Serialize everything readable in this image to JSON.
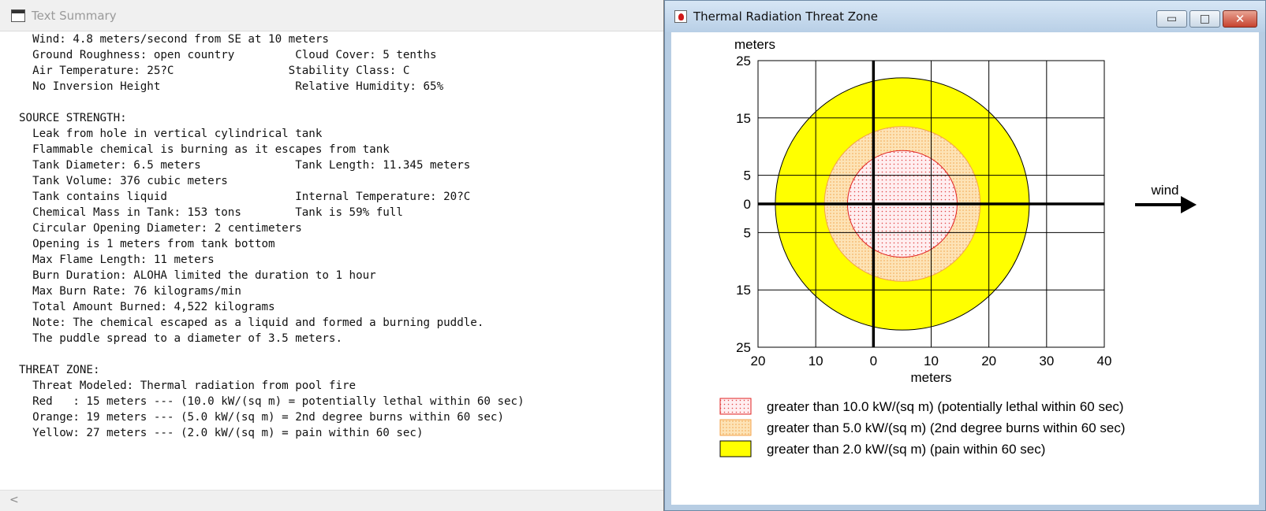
{
  "left_window": {
    "title": "Text Summary",
    "lines": [
      "  Wind: 4.8 meters/second from SE at 10 meters",
      "  Ground Roughness: open country         Cloud Cover: 5 tenths",
      "  Air Temperature: 25?C                 Stability Class: C",
      "  No Inversion Height                    Relative Humidity: 65%",
      "",
      "SOURCE STRENGTH:",
      "  Leak from hole in vertical cylindrical tank",
      "  Flammable chemical is burning as it escapes from tank",
      "  Tank Diameter: 6.5 meters              Tank Length: 11.345 meters",
      "  Tank Volume: 376 cubic meters",
      "  Tank contains liquid                   Internal Temperature: 20?C",
      "  Chemical Mass in Tank: 153 tons        Tank is 59% full",
      "  Circular Opening Diameter: 2 centimeters",
      "  Opening is 1 meters from tank bottom",
      "  Max Flame Length: 11 meters",
      "  Burn Duration: ALOHA limited the duration to 1 hour",
      "  Max Burn Rate: 76 kilograms/min",
      "  Total Amount Burned: 4,522 kilograms",
      "  Note: The chemical escaped as a liquid and formed a burning puddle.",
      "  The puddle spread to a diameter of 3.5 meters.",
      "",
      "THREAT ZONE:",
      "  Threat Modeled: Thermal radiation from pool fire",
      "  Red   : 15 meters --- (10.0 kW/(sq m) = potentially lethal within 60 sec)",
      "  Orange: 19 meters --- (5.0 kW/(sq m) = 2nd degree burns within 60 sec)",
      "  Yellow: 27 meters --- (2.0 kW/(sq m) = pain within 60 sec)"
    ],
    "scroll_left_glyph": "<"
  },
  "right_window": {
    "title": "Thermal Radiation Threat Zone",
    "controls": {
      "minimize": "▭",
      "maximize": "□",
      "close": "✕"
    }
  },
  "chart_data": {
    "type": "threat-zone-plot",
    "xlabel": "meters",
    "ylabel": "meters",
    "xlim": [
      -20,
      40
    ],
    "ylim": [
      -25,
      25
    ],
    "x_ticks": [
      -20,
      -10,
      0,
      10,
      20,
      30,
      40
    ],
    "x_tick_labels": [
      "20",
      "10",
      "0",
      "10",
      "20",
      "30",
      "40"
    ],
    "y_ticks": [
      25,
      15,
      5,
      0,
      -5,
      -15,
      -25
    ],
    "y_tick_labels": [
      "25",
      "15",
      "5",
      "0",
      "5",
      "15",
      "25"
    ],
    "grid": true,
    "wind_label": "wind",
    "zones": [
      {
        "level": "yellow",
        "center_x": 5,
        "rx": 22,
        "ry": 22,
        "fill": "#ffff00",
        "stroke": "#000000",
        "pattern": "solid",
        "legend": "greater than 2.0 kW/(sq m) (pain within 60 sec)"
      },
      {
        "level": "orange",
        "center_x": 5,
        "rx": 13.5,
        "ry": 13.5,
        "fill": "#fde3b6",
        "stroke": "#f3a24a",
        "pattern": "dots-orange",
        "legend": "greater than 5.0 kW/(sq m) (2nd degree burns within 60 sec)"
      },
      {
        "level": "red",
        "center_x": 5,
        "rx": 9.5,
        "ry": 9.3,
        "fill": "#ffeef0",
        "stroke": "#e02020",
        "pattern": "dots-red",
        "legend": "greater than 10.0 kW/(sq m) (potentially lethal within 60 sec)"
      }
    ],
    "legend_order": [
      "red",
      "orange",
      "yellow"
    ]
  }
}
